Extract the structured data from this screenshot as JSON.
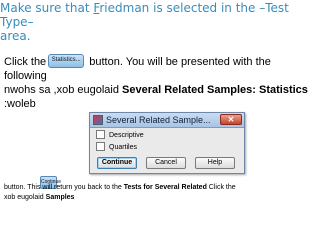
{
  "heading": {
    "part1": "Make sure that ",
    "underlined": "F",
    "part2": "riedman is selected in the –Test Type–",
    "line2": "area."
  },
  "instruction": {
    "click_prefix": "Click the",
    "button_label": "Statistics...",
    "click_suffix": " button. You will be presented with the following",
    "line2_plain": "nwohs sa ,xob eugolaid ",
    "line2_bold": "Several Related Samples: Statistics",
    "line3": ":woleb"
  },
  "dialog": {
    "title": "Several Related Sample...",
    "close_icon": "close-icon",
    "options": [
      {
        "label": "Descriptive",
        "checked": false
      },
      {
        "label": "Quartiles",
        "checked": false
      }
    ],
    "buttons": {
      "continue": "Continue",
      "cancel": "Cancel",
      "help": "Help"
    }
  },
  "footer": {
    "small_button_label": "Continue",
    "text_plain1": "button. This will return you back to the ",
    "text_bold1": "Tests for Several Related",
    "text_plain2": "  Click the",
    "line2_plain": "xob eugolaid ",
    "line2_bold": "Samples"
  }
}
